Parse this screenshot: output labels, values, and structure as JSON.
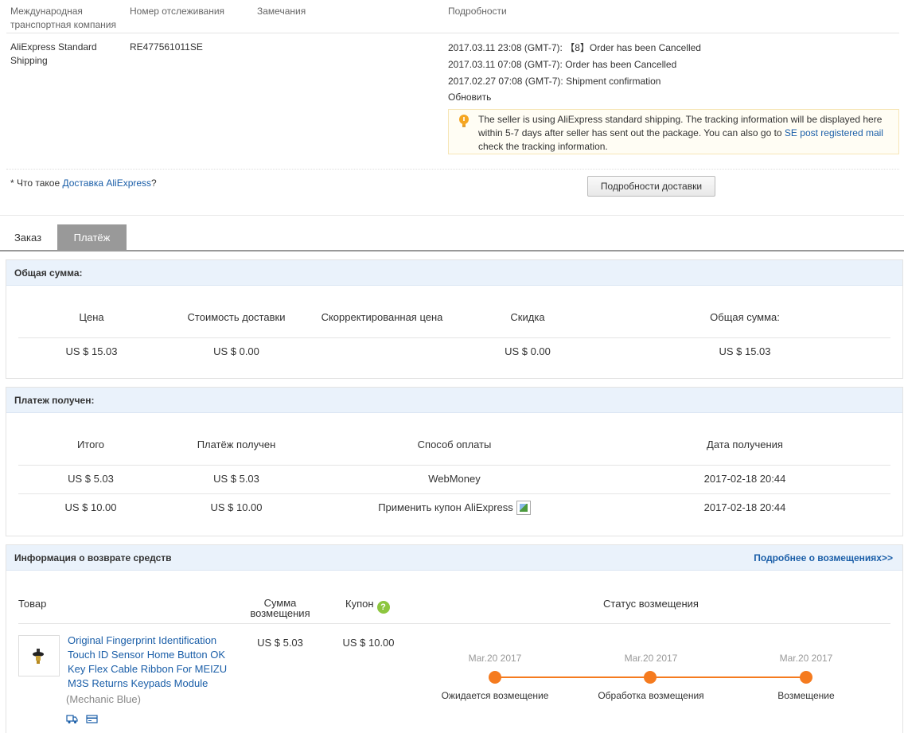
{
  "tracking": {
    "headers": {
      "carrier": "Международная транспортная компания",
      "number": "Номер отслеживания",
      "remarks": "Замечания",
      "details": "Подробности"
    },
    "carrier": "AliExpress Standard Shipping",
    "number": "RE477561011SE",
    "events": [
      "2017.03.11 23:08 (GMT-7): 【8】Order has been Cancelled",
      "2017.03.11 07:08 (GMT-7): Order has been Cancelled",
      "2017.02.27 07:08 (GMT-7): Shipment confirmation"
    ],
    "refresh": "Обновить",
    "notice": {
      "text_before": "The seller is using AliExpress standard shipping. The tracking information will be displayed here within 5-7 days after seller has sent out the package. You can also go to ",
      "link": "SE post registered mail",
      "text_after": " check the tracking information."
    },
    "whatis_prefix": "* Что такое ",
    "whatis_link": "Доставка AliExpress",
    "whatis_suffix": "?",
    "delivery_button": "Подробности доставки"
  },
  "tabs": {
    "order": "Заказ",
    "payment": "Платёж"
  },
  "total": {
    "title": "Общая сумма:",
    "headers": [
      "Цена",
      "Стоимость доставки",
      "Скорректированная цена",
      "Скидка",
      "Общая сумма:"
    ],
    "values": [
      "US $ 15.03",
      "US $ 0.00",
      "",
      "US $ 0.00",
      "US $ 15.03"
    ]
  },
  "payment": {
    "title": "Платеж получен:",
    "headers": [
      "Итого",
      "Платёж получен",
      "Способ оплаты",
      "Дата получения"
    ],
    "rows": [
      [
        "US $ 5.03",
        "US $ 5.03",
        "WebMoney",
        "2017-02-18 20:44"
      ],
      [
        "US $ 10.00",
        "US $ 10.00",
        "Применить купон AliExpress",
        "2017-02-18 20:44"
      ]
    ]
  },
  "refund": {
    "title": "Информация о возврате средств",
    "more_link": "Подробнее о возмещениях>>",
    "headers": {
      "product": "Товар",
      "amount": "Сумма возмещения",
      "coupon": "Купон",
      "status": "Статус возмещения"
    },
    "product_title": "Original Fingerprint Identification Touch ID Sensor Home Button OK Key Flex Cable Ribbon For MEIZU M3S Returns Keypads Module",
    "product_variant": "(Mechanic Blue)",
    "amount": "US $ 5.03",
    "coupon": "US $ 10.00",
    "timeline": [
      {
        "date": "Mar.20 2017",
        "label": "Ожидается возмещение"
      },
      {
        "date": "Mar.20 2017",
        "label": "Обработка возмещения"
      },
      {
        "date": "Mar.20 2017",
        "label": "Возмещение"
      }
    ]
  },
  "colors": {
    "accent": "#f57b1f",
    "link": "#1a5ea8",
    "panel_header": "#eaf2fb",
    "help": "#8dc63f"
  }
}
